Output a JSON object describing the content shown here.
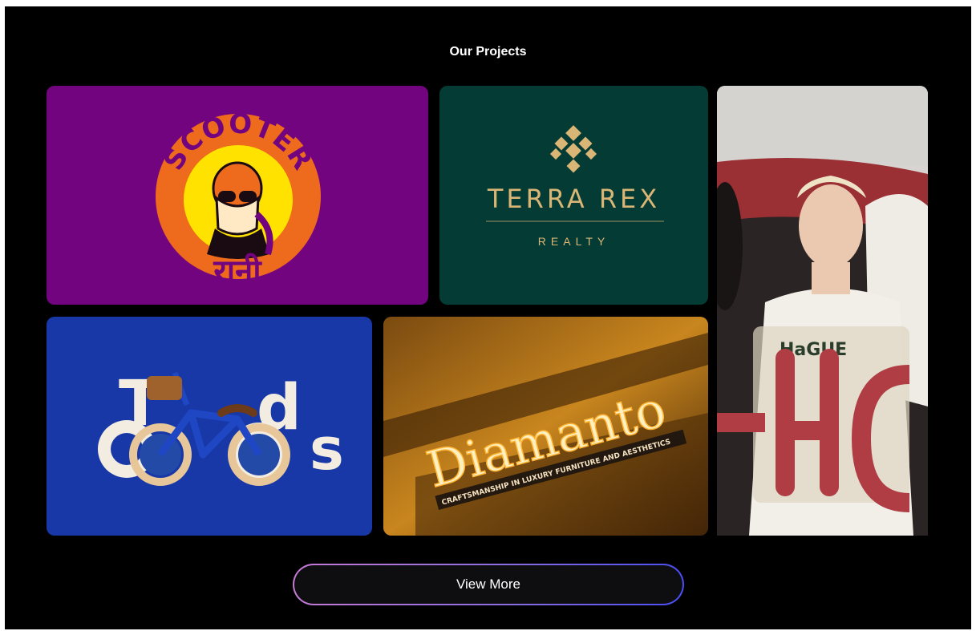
{
  "section": {
    "title": "Our Projects"
  },
  "projects": [
    {
      "id": "scooter-rani",
      "brand_text": "SCOOTER",
      "script_text": "रानी",
      "bg": "#72047f"
    },
    {
      "id": "terra-rex",
      "title": "TERRA REX",
      "subtitle": "REALTY",
      "bg": "#043b34",
      "accent": "#d9b676"
    },
    {
      "id": "hague",
      "shirt_text": "HaGUE",
      "bg": "#d7d4d1"
    },
    {
      "id": "toddo",
      "letters": [
        "T",
        "d",
        "s"
      ],
      "bg": "#1738a6"
    },
    {
      "id": "diamanto",
      "sign_text": "Diamanto",
      "tagline": "CRAFTSMANSHIP IN LUXURY FURNITURE AND AESTHETICS",
      "bg": "#3a1d04"
    }
  ],
  "cta": {
    "label": "View More"
  }
}
